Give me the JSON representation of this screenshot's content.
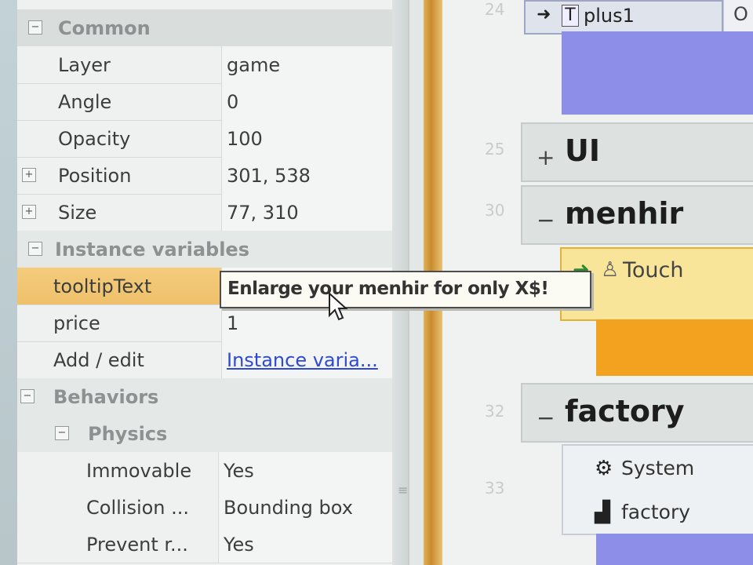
{
  "properties": {
    "common_header": "Common",
    "rows": [
      {
        "label": "Layer",
        "value": "game"
      },
      {
        "label": "Angle",
        "value": "0"
      },
      {
        "label": "Opacity",
        "value": "100"
      },
      {
        "label": "Position",
        "value": "301, 538"
      },
      {
        "label": "Size",
        "value": "77, 310"
      }
    ],
    "instance_header": "Instance variables",
    "instance_rows": [
      {
        "label": "tooltipText",
        "value": ""
      },
      {
        "label": "price",
        "value": "1"
      },
      {
        "label": "Add / edit",
        "value": "Instance varia..."
      }
    ],
    "behaviors_header": "Behaviors",
    "physics_header": "Physics",
    "physics_rows": [
      {
        "label": "Immovable",
        "value": "Yes"
      },
      {
        "label": "Collision ...",
        "value": "Bounding box"
      },
      {
        "label": "Prevent r...",
        "value": "Yes"
      }
    ],
    "expand_symbol": "⊞",
    "collapse_symbol": "⊟"
  },
  "tooltip": {
    "text": "Enlarge your menhir for only X$!"
  },
  "event_sheet": {
    "line_numbers": [
      "24",
      "25",
      "30",
      "32",
      "33"
    ],
    "top_event": {
      "object": "plus1",
      "type_letter": "T",
      "next": "O"
    },
    "groups": [
      {
        "toggle": "+",
        "name": "UI"
      },
      {
        "toggle": "−",
        "name": "menhir"
      },
      {
        "toggle": "−",
        "name": "factory"
      }
    ],
    "touch_condition": "Touch",
    "factory_items": [
      {
        "icon": "gear-icon",
        "label": "System"
      },
      {
        "icon": "factory-icon",
        "label": "factory"
      }
    ]
  },
  "colors": {
    "selected_row": "#f0c46f",
    "splitter": "#d49a3a",
    "touch_condition": "#f8e59a",
    "orange_action": "#f2a21f",
    "purple_action": "#8d8ee8",
    "link": "#2f49d0"
  }
}
